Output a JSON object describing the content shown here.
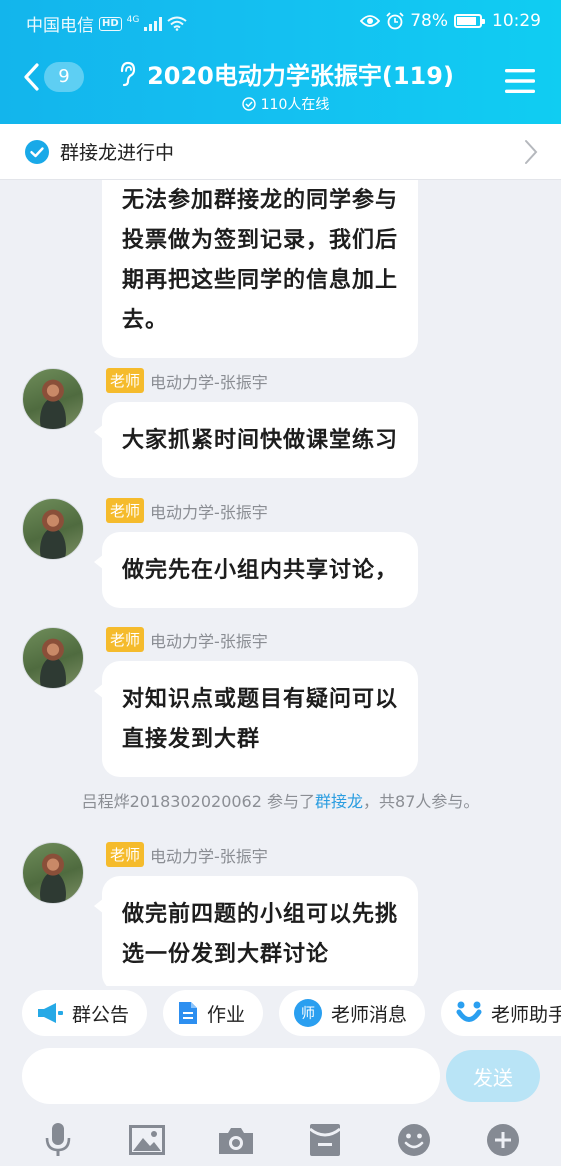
{
  "status_bar": {
    "carrier": "中国电信",
    "hd": "HD",
    "network": "4G",
    "battery": "78%",
    "time": "10:29"
  },
  "header": {
    "back_count": "9",
    "title": "2020电动力学张振宇(119)",
    "online": "110人在线"
  },
  "banner": {
    "text": "群接龙进行中"
  },
  "messages": [
    {
      "text_lines": [
        "无法参加群接龙的同学参与",
        "投票做为签到记录，我们后",
        "期再把这些同学的信息加上",
        "去。"
      ]
    },
    {
      "role": "老师",
      "sender": "电动力学-张振宇",
      "text_lines": [
        "大家抓紧时间快做课堂练习"
      ]
    },
    {
      "role": "老师",
      "sender": "电动力学-张振宇",
      "text_lines": [
        "做完先在小组内共享讨论，"
      ]
    },
    {
      "role": "老师",
      "sender": "电动力学-张振宇",
      "text_lines": [
        "对知识点或题目有疑问可以",
        "直接发到大群"
      ]
    },
    {
      "role": "老师",
      "sender": "电动力学-张振宇",
      "text_lines": [
        "做完前四题的小组可以先挑",
        "选一份发到大群讨论"
      ]
    }
  ],
  "system_notice": {
    "prefix": "吕程烨2018302020062 参与了",
    "link": "群接龙",
    "suffix": "，共87人参与。"
  },
  "shortcuts": [
    {
      "label": "群公告",
      "icon": "megaphone-icon"
    },
    {
      "label": "作业",
      "icon": "document-icon"
    },
    {
      "label": "老师消息",
      "icon": "teacher-badge-icon"
    },
    {
      "label": "老师助手",
      "icon": "assistant-icon"
    }
  ],
  "input": {
    "placeholder": "",
    "send_label": "发送"
  },
  "toolbar_icons": [
    "microphone-icon",
    "image-icon",
    "camera-icon",
    "red-packet-icon",
    "emoji-icon",
    "plus-icon"
  ],
  "colors": {
    "header": "#14bdf0",
    "role_tag": "#f5bb2c",
    "link": "#2a9de0",
    "send_disabled": "#b9e4f6",
    "background": "#eef0f5"
  }
}
